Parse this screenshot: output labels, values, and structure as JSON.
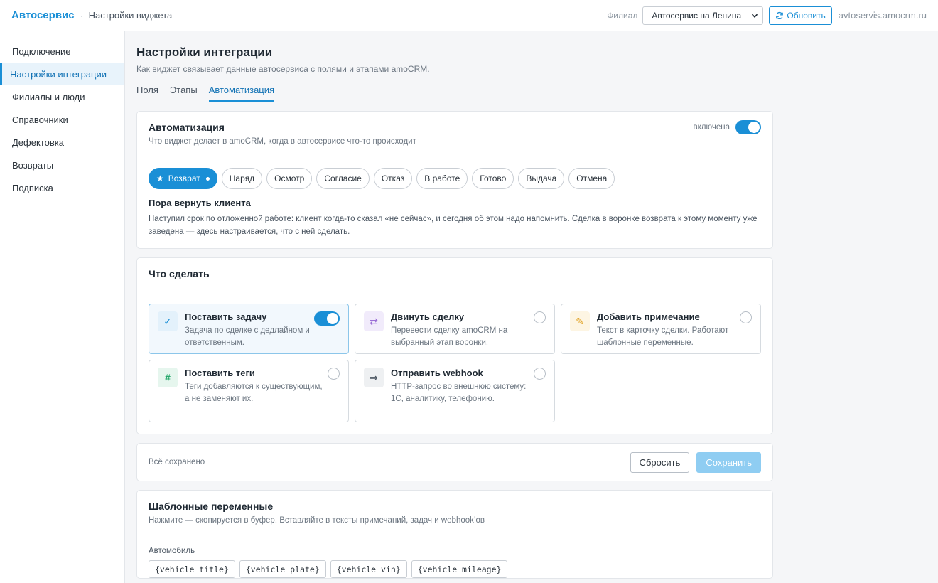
{
  "header": {
    "brand": "Автосервис",
    "crumb": "Настройки виджета",
    "branch_label": "Филиал",
    "branch_value": "Автосервис на Ленина",
    "refresh_label": "Обновить",
    "domain": "avtoservis.amocrm.ru"
  },
  "sidebar": {
    "items": [
      {
        "label": "Подключение",
        "active": false
      },
      {
        "label": "Настройки интеграции",
        "active": true
      },
      {
        "label": "Филиалы и люди",
        "active": false
      },
      {
        "label": "Справочники",
        "active": false
      },
      {
        "label": "Дефектовка",
        "active": false
      },
      {
        "label": "Возвраты",
        "active": false
      },
      {
        "label": "Подписка",
        "active": false
      }
    ]
  },
  "main": {
    "title": "Настройки интеграции",
    "subtitle": "Как виджет связывает данные автосервиса с полями и этапами amoCRM.",
    "tabs": [
      {
        "label": "Поля",
        "active": false
      },
      {
        "label": "Этапы",
        "active": false
      },
      {
        "label": "Автоматизация",
        "active": true
      }
    ]
  },
  "automation": {
    "title": "Автоматизация",
    "subtitle": "Что виджет делает в amoCRM, когда в автосервисе что-то происходит",
    "toggle_label": "включена",
    "toggle_on": true,
    "events": [
      {
        "label": "Возврат",
        "active": true
      },
      {
        "label": "Наряд",
        "active": false
      },
      {
        "label": "Осмотр",
        "active": false
      },
      {
        "label": "Согласие",
        "active": false
      },
      {
        "label": "Отказ",
        "active": false
      },
      {
        "label": "В работе",
        "active": false
      },
      {
        "label": "Готово",
        "active": false
      },
      {
        "label": "Выдача",
        "active": false
      },
      {
        "label": "Отмена",
        "active": false
      }
    ],
    "event_title": "Пора вернуть клиента",
    "event_desc": "Наступил срок по отложенной работе: клиент когда-то сказал «не сейчас», и сегодня об этом надо напомнить. Сделка в воронке возврата к этому моменту уже заведена — здесь настраивается, что с ней сделать."
  },
  "actions_card": {
    "title": "Что сделать",
    "actions": [
      {
        "title": "Поставить задачу",
        "desc": "Задача по сделке с дедлайном и ответственным.",
        "icon": "✓",
        "icon_name": "check-icon",
        "icon_color": "#1a8fd6",
        "icon_bg": "#e3f1fb",
        "enabled": true
      },
      {
        "title": "Двинуть сделку",
        "desc": "Перевести сделку amoCRM на выбранный этап воронки.",
        "icon": "⇄",
        "icon_name": "swap-arrows-icon",
        "icon_color": "#9b6fd6",
        "icon_bg": "#f1ebfb",
        "enabled": false
      },
      {
        "title": "Добавить примечание",
        "desc": "Текст в карточку сделки. Работают шаблонные переменные.",
        "icon": "✎",
        "icon_name": "pencil-icon",
        "icon_color": "#e0a020",
        "icon_bg": "#fdf5e3",
        "enabled": false
      },
      {
        "title": "Поставить теги",
        "desc": "Теги добавляются к существующим, а не заменяют их.",
        "icon": "#",
        "icon_name": "hash-icon",
        "icon_color": "#26a86b",
        "icon_bg": "#e6f6ee",
        "enabled": false
      },
      {
        "title": "Отправить webhook",
        "desc": "HTTP-запрос во внешнюю систему: 1С, аналитику, телефонию.",
        "icon": "⇒",
        "icon_name": "arrow-right-icon",
        "icon_color": "#4a5561",
        "icon_bg": "#eef0f2",
        "enabled": false
      }
    ]
  },
  "savebar": {
    "status": "Всё сохранено",
    "reset_label": "Сбросить",
    "save_label": "Сохранить"
  },
  "variables": {
    "title": "Шаблонные переменные",
    "subtitle": "Нажмите — скопируется в буфер. Вставляйте в тексты примечаний, задач и webhook’ов",
    "group_label": "Автомобиль",
    "tags": [
      "{vehicle_title}",
      "{vehicle_plate}",
      "{vehicle_vin}",
      "{vehicle_mileage}"
    ]
  },
  "colors": {
    "accent": "#1a8fd6",
    "save_disabled": "#8fcdf2"
  }
}
